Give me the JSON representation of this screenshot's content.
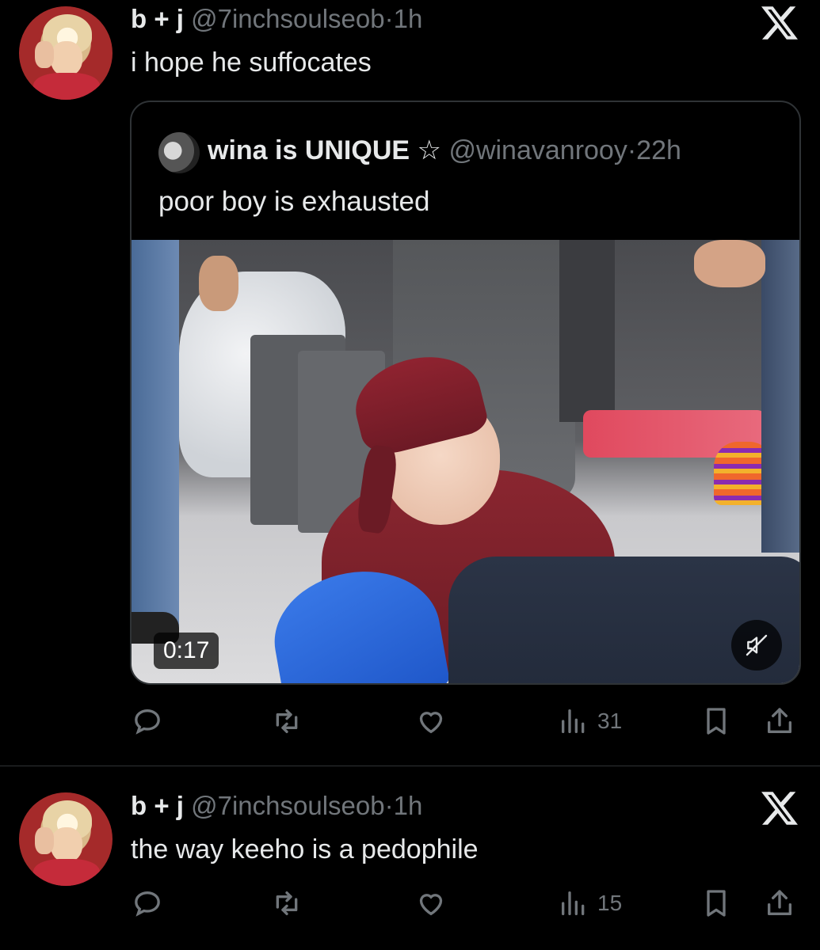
{
  "tweets": [
    {
      "display_name": "b + j",
      "handle": "@7inchsoulseob",
      "separator": "·",
      "time": "1h",
      "text": "i hope he suffocates",
      "quote": {
        "display_name": "wina is UNIQUE ☆",
        "handle": "@winavanrooy",
        "separator": "·",
        "time": "22h",
        "text": "poor boy is exhausted",
        "video": {
          "duration": "0:17",
          "muted": true
        }
      },
      "views": "31"
    },
    {
      "display_name": "b + j",
      "handle": "@7inchsoulseob",
      "separator": "·",
      "time": "1h",
      "text": "the way keeho is a pedophile",
      "views": "15"
    }
  ],
  "icons": {
    "reply": "reply-icon",
    "retweet": "retweet-icon",
    "like": "heart-icon",
    "views": "views-icon",
    "bookmark": "bookmark-icon",
    "share": "share-icon",
    "platform": "x-logo-icon",
    "mute": "muted-speaker-icon"
  },
  "colors": {
    "background": "#000000",
    "text": "#e7e9ea",
    "secondary": "#71767b",
    "border": "#2f3336"
  }
}
